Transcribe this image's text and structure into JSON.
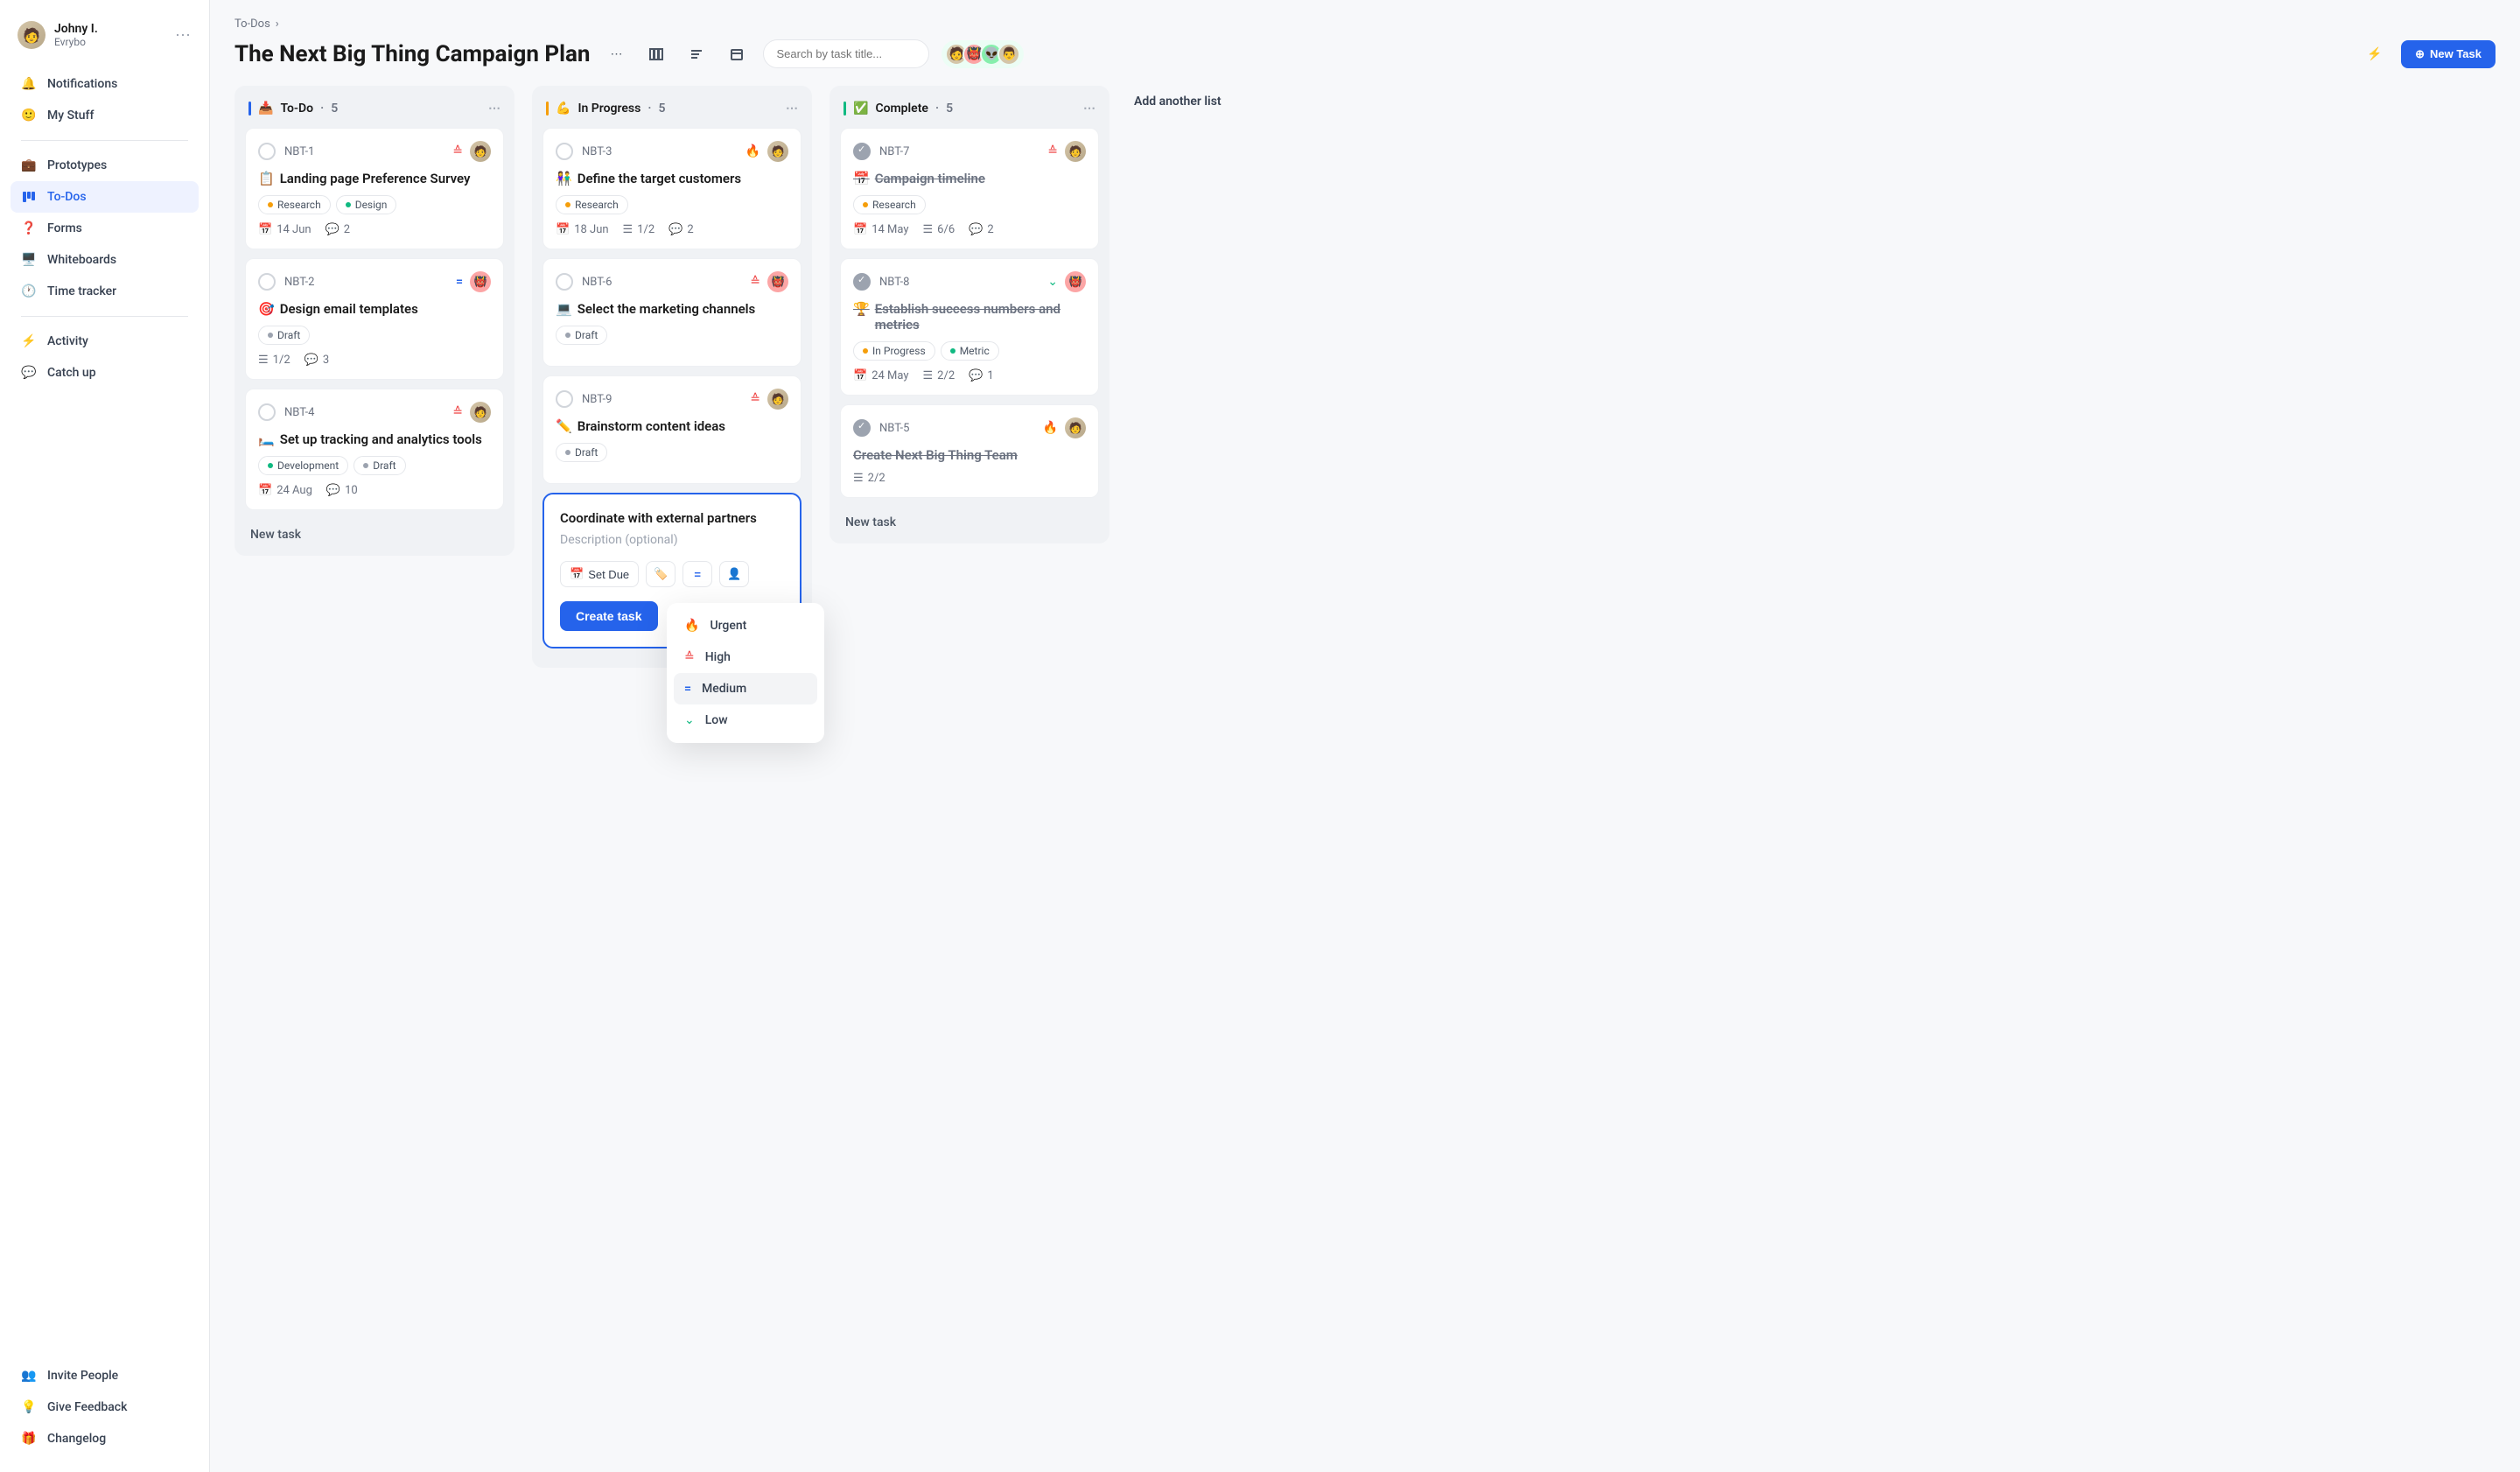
{
  "user": {
    "name": "Johny I.",
    "org": "Evrybo"
  },
  "nav": {
    "notifications": "Notifications",
    "mystuff": "My Stuff",
    "prototypes": "Prototypes",
    "todos": "To-Dos",
    "forms": "Forms",
    "whiteboards": "Whiteboards",
    "timetracker": "Time tracker",
    "activity": "Activity",
    "catchup": "Catch up",
    "invite": "Invite People",
    "feedback": "Give Feedback",
    "changelog": "Changelog"
  },
  "breadcrumb": "To-Dos",
  "title": "The Next Big Thing Campaign Plan",
  "search_placeholder": "Search by task title...",
  "new_task_btn": "New Task",
  "add_list": "Add another list",
  "new_task_link": "New task",
  "columns": {
    "todo": {
      "emoji": "📥",
      "label": "To-Do",
      "count": "5",
      "bar": "#2563eb"
    },
    "progress": {
      "emoji": "💪",
      "label": "In Progress",
      "count": "5",
      "bar": "#f59e0b"
    },
    "complete": {
      "emoji": "✅",
      "label": "Complete",
      "count": "5",
      "bar": "#10b981"
    }
  },
  "cards": {
    "nbt1": {
      "id": "NBT-1",
      "emoji": "📋",
      "title": "Landing page Preference Survey",
      "date": "14 Jun",
      "comments": "2",
      "tags": [
        {
          "dot": "#f59e0b",
          "label": "Research"
        },
        {
          "dot": "#10b981",
          "label": "Design"
        }
      ]
    },
    "nbt2": {
      "id": "NBT-2",
      "emoji": "🎯",
      "title": "Design email templates",
      "sub": "1/2",
      "comments": "3",
      "tags": [
        {
          "dot": "#9ca3af",
          "label": "Draft"
        }
      ]
    },
    "nbt4": {
      "id": "NBT-4",
      "emoji": "🛏️",
      "title": "Set up tracking and analytics tools",
      "date": "24 Aug",
      "comments": "10",
      "tags": [
        {
          "dot": "#10b981",
          "label": "Development"
        },
        {
          "dot": "#9ca3af",
          "label": "Draft"
        }
      ]
    },
    "nbt3": {
      "id": "NBT-3",
      "emoji": "👫",
      "title": "Define the target customers",
      "date": "18 Jun",
      "sub": "1/2",
      "comments": "2",
      "tags": [
        {
          "dot": "#f59e0b",
          "label": "Research"
        }
      ]
    },
    "nbt6": {
      "id": "NBT-6",
      "emoji": "💻",
      "title": "Select the marketing channels",
      "tags": [
        {
          "dot": "#9ca3af",
          "label": "Draft"
        }
      ]
    },
    "nbt9": {
      "id": "NBT-9",
      "emoji": "✏️",
      "title": "Brainstorm content ideas",
      "tags": [
        {
          "dot": "#9ca3af",
          "label": "Draft"
        }
      ]
    },
    "nbt7": {
      "id": "NBT-7",
      "emoji": "📅",
      "title": "Campaign timeline",
      "date": "14 May",
      "sub": "6/6",
      "comments": "2",
      "tags": [
        {
          "dot": "#f59e0b",
          "label": "Research"
        }
      ]
    },
    "nbt8": {
      "id": "NBT-8",
      "emoji": "🏆",
      "title": "Establish success numbers and metrics",
      "date": "24 May",
      "sub": "2/2",
      "comments": "1",
      "tags": [
        {
          "dot": "#f59e0b",
          "label": "In Progress"
        },
        {
          "dot": "#10b981",
          "label": "Metric"
        }
      ]
    },
    "nbt5": {
      "id": "NBT-5",
      "title": "Create Next Big Thing Team",
      "sub": "2/2"
    }
  },
  "new_card": {
    "title": "Coordinate with external partners",
    "desc_placeholder": "Description (optional)",
    "set_due": "Set Due",
    "create": "Create task"
  },
  "priority_menu": {
    "urgent": "Urgent",
    "high": "High",
    "medium": "Medium",
    "low": "Low"
  },
  "avatars": {
    "a1": {
      "bg": "#d4c5a8",
      "emoji": "🧑"
    },
    "a2": {
      "bg": "#ef4444",
      "emoji": "👹"
    },
    "a3": {
      "bg": "#10b981",
      "emoji": "👽"
    },
    "a4": {
      "bg": "#d4c5a8",
      "emoji": "👨"
    }
  }
}
